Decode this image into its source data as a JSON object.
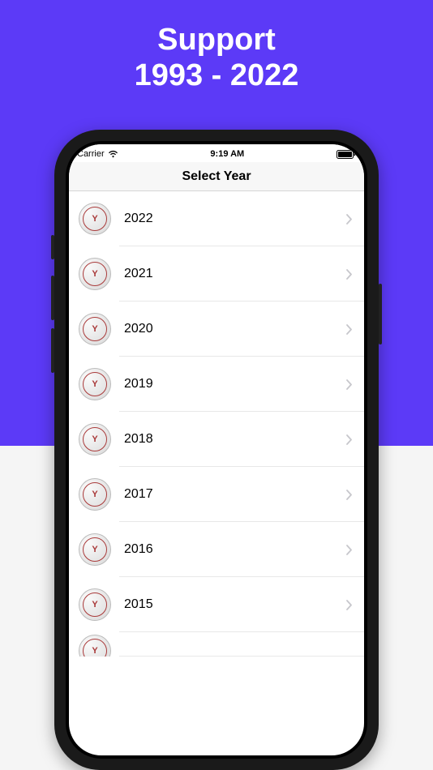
{
  "promo": {
    "line1": "Support",
    "line2": "1993 - 2022"
  },
  "status": {
    "carrier": "Carrier",
    "time": "9:19 AM"
  },
  "nav": {
    "title": "Select Year"
  },
  "icon": {
    "letter": "Y"
  },
  "years": [
    {
      "label": "2022"
    },
    {
      "label": "2021"
    },
    {
      "label": "2020"
    },
    {
      "label": "2019"
    },
    {
      "label": "2018"
    },
    {
      "label": "2017"
    },
    {
      "label": "2016"
    },
    {
      "label": "2015"
    }
  ]
}
